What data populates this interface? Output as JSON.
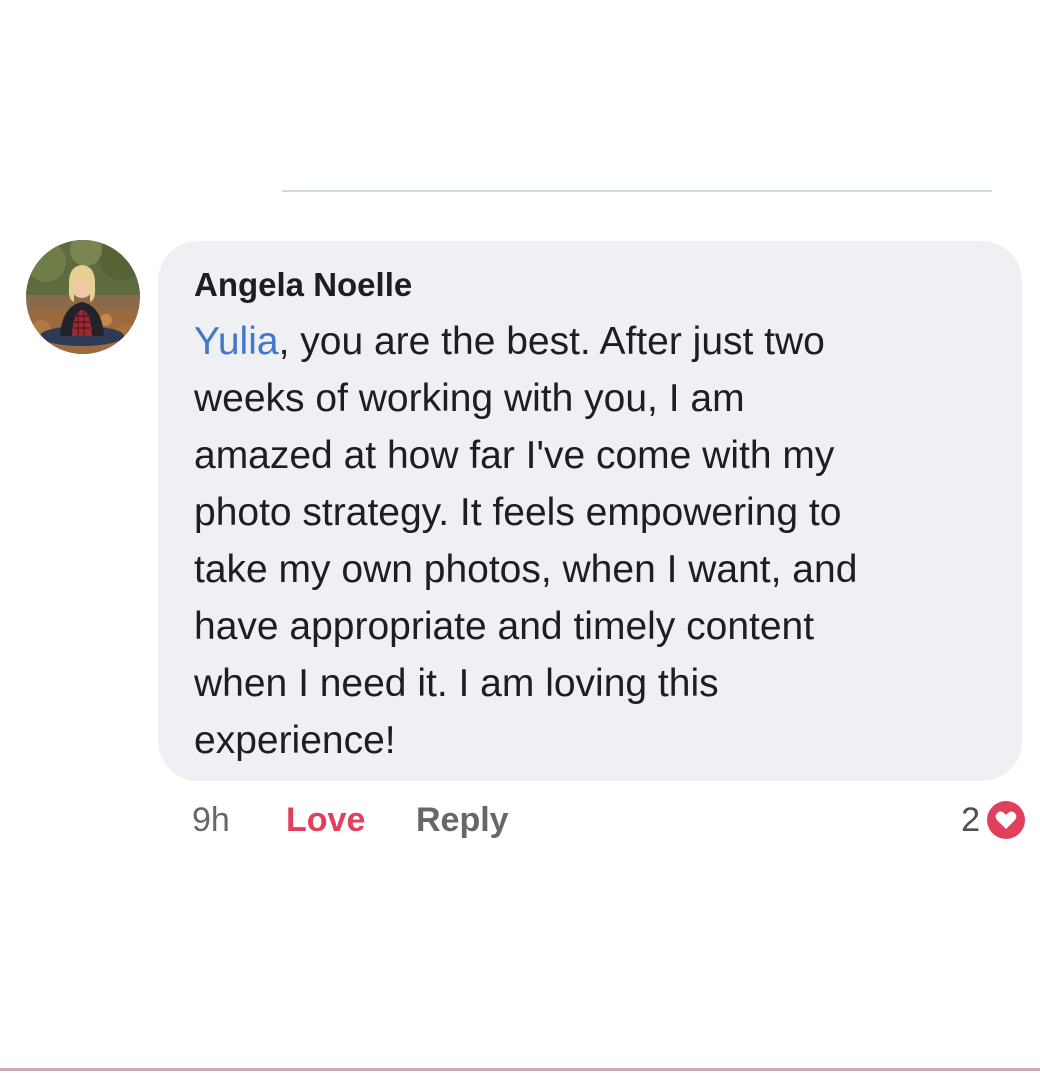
{
  "comment": {
    "author": "Angela Noelle",
    "mention": "Yulia",
    "text": ", you are the best.  After just two\nweeks of working with you, I am\namazed at how far I've come with my\nphoto strategy.  It feels empowering to\ntake my own photos, when I want, and\nhave appropriate and timely content\nwhen I need it.  I am loving this\nexperience!"
  },
  "actions": {
    "time": "9h",
    "love_label": "Love",
    "reply_label": "Reply"
  },
  "reactions": {
    "count": "2",
    "icon": "heart-icon",
    "color": "#e0405e"
  },
  "colors": {
    "bubble": "#eef0f3",
    "mention": "#4476c9",
    "love": "#e0405e",
    "secondary_text": "#65676b"
  }
}
